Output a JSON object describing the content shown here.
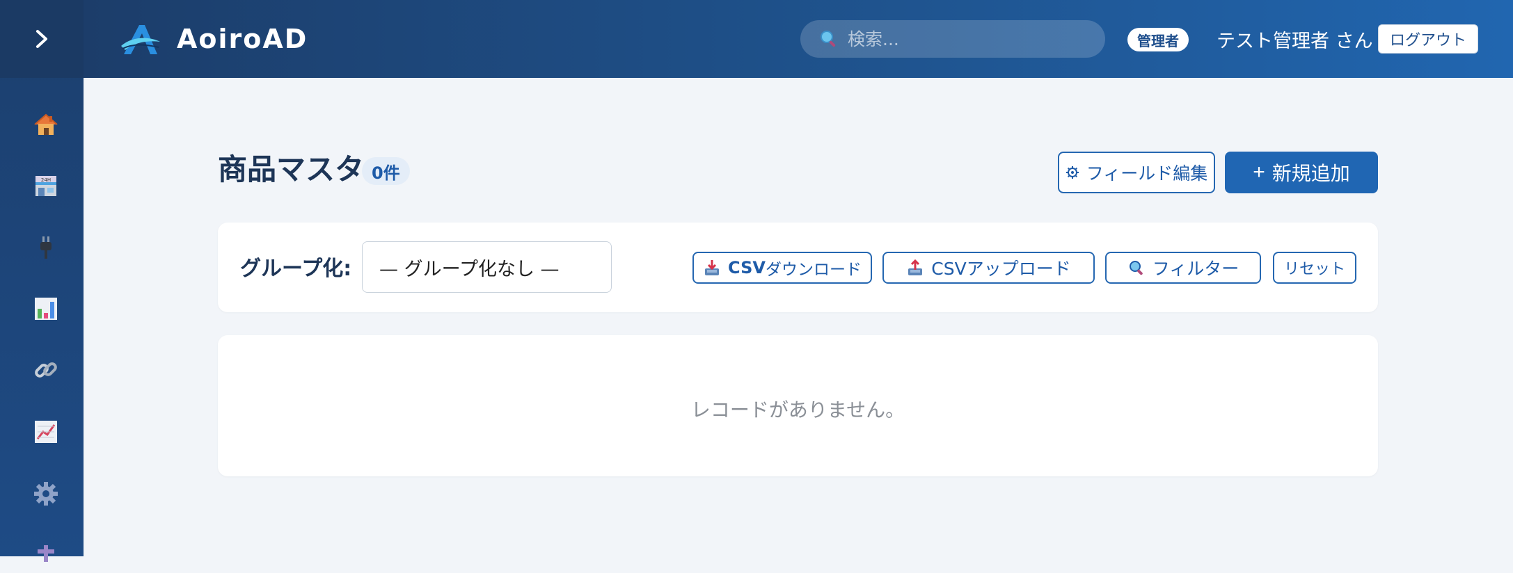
{
  "app": {
    "name": "AoiroAD"
  },
  "sidebar": {
    "toggle_icon": "chevron-right-icon",
    "items": [
      {
        "icon": "home-icon"
      },
      {
        "icon": "store-icon"
      },
      {
        "icon": "plug-icon"
      },
      {
        "icon": "bar-chart-icon"
      },
      {
        "icon": "link-icon"
      },
      {
        "icon": "trend-chart-icon"
      },
      {
        "icon": "gear-icon"
      },
      {
        "icon": "extra-icon"
      }
    ]
  },
  "header": {
    "search_placeholder": "検索...",
    "role_badge": "管理者",
    "user_name": "テスト管理者 さん",
    "logout_label": "ログアウト"
  },
  "page": {
    "title": "商品マスタ",
    "count_badge": "0件",
    "field_edit_label": "フィールド編集",
    "add_new_label": "新規追加"
  },
  "toolbar": {
    "group_label": "グループ化:",
    "group_value": "— グループ化なし —",
    "csv_download_prefix": "CSV",
    "csv_download_suffix": "ダウンロード",
    "csv_upload_label": "CSVアップロード",
    "filter_label": "フィルター",
    "reset_label": "リセット"
  },
  "content": {
    "empty_message": "レコードがありません。"
  },
  "colors": {
    "header_start": "#1c3d6a",
    "header_end": "#2166b0",
    "accent": "#2066b3",
    "background": "#f2f5f9"
  }
}
